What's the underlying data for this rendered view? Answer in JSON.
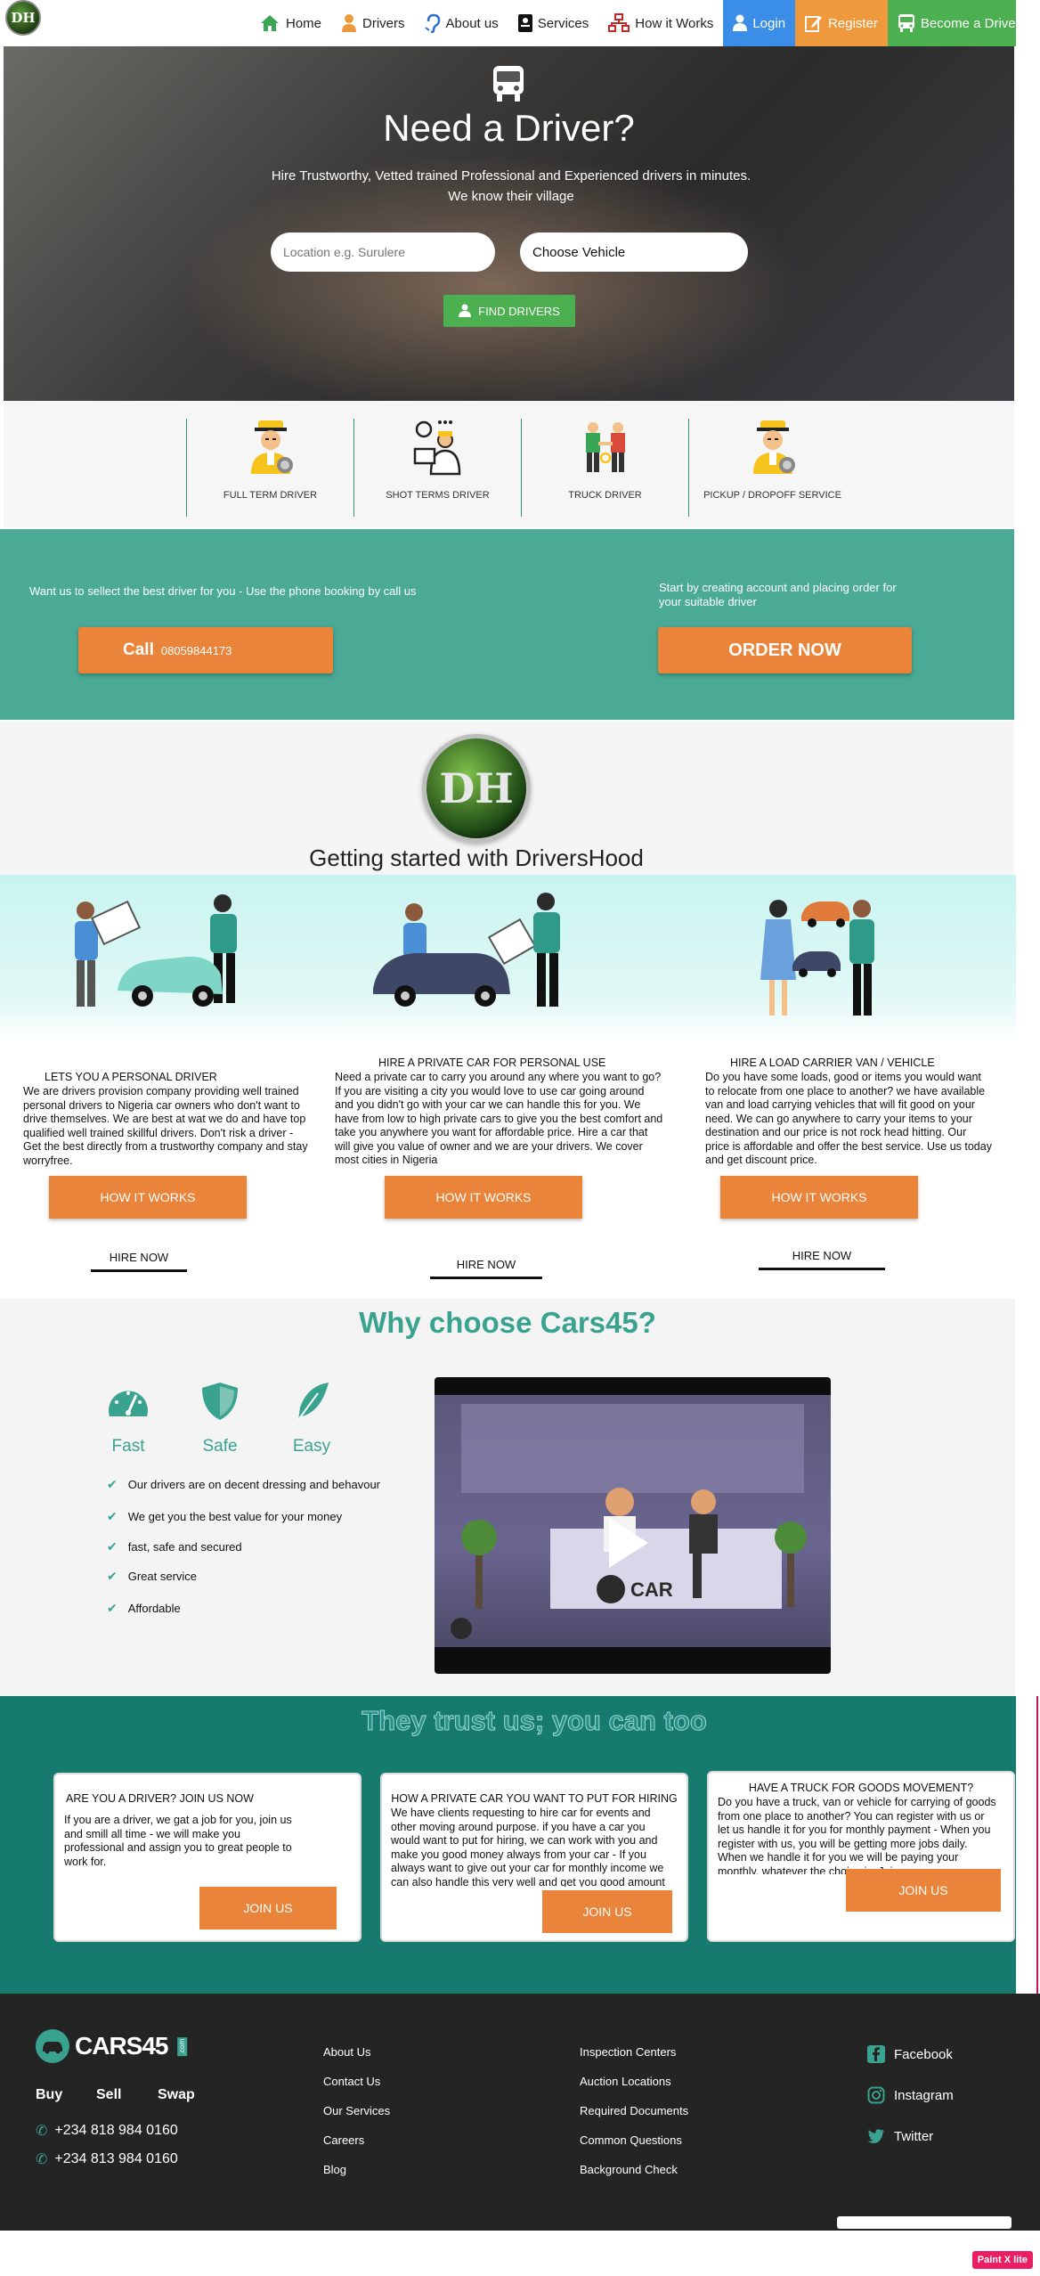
{
  "nav": {
    "items": [
      {
        "label": "Home",
        "icon": "home-icon"
      },
      {
        "label": "Drivers",
        "icon": "driver-icon"
      },
      {
        "label": "About us",
        "icon": "ear-icon"
      },
      {
        "label": "Services",
        "icon": "id-card-icon"
      },
      {
        "label": "How it Works",
        "icon": "sitemap-icon"
      }
    ],
    "login": "Login",
    "register": "Register",
    "become": "Become a Driver"
  },
  "hero": {
    "title": "Need a Driver?",
    "subtitle": "Hire Trustworthy, Vetted trained Professional and Experienced drivers in minutes. We know their village",
    "location_placeholder": "Location e.g. Surulere",
    "vehicle_select": "Choose Vehicle",
    "find_button": "FIND DRIVERS"
  },
  "services": [
    {
      "label": "FULL TERM DRIVER"
    },
    {
      "label": "SHOT TERMS DRIVER"
    },
    {
      "label": "TRUCK DRIVER"
    },
    {
      "label": "PICKUP / DROPOFF SERVICE"
    }
  ],
  "booking": {
    "left_text": "Want us to sellect the best driver for you - Use the phone booking by call us",
    "call_label": "Call",
    "call_number": "08059844173",
    "right_text": "Start by creating account and placing order for your suitable driver",
    "order_button": "ORDER NOW"
  },
  "getting_started": {
    "logo_text": "DH",
    "title": "Getting started with DriversHood"
  },
  "steps": [
    {
      "title": "LETS YOU A PERSONAL DRIVER",
      "desc": "We are drivers provision company providing well trained personal drivers to Nigeria car owners who don't want to drive themselves. We are best at wat we do and have top qualified well trained skillful drivers. Don't risk a driver - Get the best directly from a trustworthy company and stay worryfree.",
      "button": "HOW IT WORKS",
      "link": "HIRE NOW"
    },
    {
      "title": "HIRE A PRIVATE CAR FOR PERSONAL USE",
      "desc": "Need a private car to carry you around any where you want to go? If you are visiting a city you would love to use car going around and you didn't go with your car we can handle this for you. We have from low to high private cars to give you the best comfort and take you anywhere you want for affordable price. Hire a car that will give you value of owner and we are your drivers. We cover most cities in Nigeria",
      "button": "HOW IT WORKS",
      "link": "HIRE NOW"
    },
    {
      "title": "HIRE A LOAD CARRIER VAN / VEHICLE",
      "desc": "Do you have some loads, good or items you would want to relocate from one place to another? we have available van and load carrying vehicles that will fit good on your need. We can go anywhere to carry your items to your destination and our price is not rock head hitting. Our price is affordable and offer the best service. Use us today and get discount price.",
      "button": "HOW IT WORKS",
      "link": "HIRE NOW"
    }
  ],
  "why": {
    "title": "Why choose Cars45?",
    "features": [
      {
        "label": "Fast",
        "icon": "speedometer-icon"
      },
      {
        "label": "Safe",
        "icon": "shield-icon"
      },
      {
        "label": "Easy",
        "icon": "feather-icon"
      }
    ],
    "checks": [
      "Our drivers are on decent dressing and behavour",
      "We get you the best value for your money",
      "fast, safe and secured",
      "Great service",
      "Affordable"
    ]
  },
  "trust": {
    "title": "They trust us; you can too",
    "cards": [
      {
        "title": "ARE YOU A DRIVER? JOIN US NOW",
        "desc": "If you are a driver, we gat a job for you, join us and smill all time - we will make you professional and assign you to great people to work for.",
        "button": "JOIN US"
      },
      {
        "title": "HOW A PRIVATE CAR YOU WANT TO PUT FOR HIRING",
        "desc": "We have clients requesting to hire car for events and other moving around purpose. if you have a car you would want to put for hiring, we can work with you and make you good money always from your car - If you always want to give out your car for monthly income we can also handle this very well and get you good amount monthly",
        "button": "JOIN US"
      },
      {
        "title": "HAVE A TRUCK FOR GOODS MOVEMENT?",
        "desc": "Do you have a truck, van or vehicle for carrying of goods from one place to another? You can register with us or let us handle it for you for monthly payment - When you register with us, you will be getting more jobs daily. When we handle it for you we will be paying your monthly, whatever the choice is. Join us",
        "button": "JOIN US"
      }
    ]
  },
  "footer": {
    "brand": "CARS45",
    "brand_tag": ".com",
    "buy": "Buy",
    "sell": "Sell",
    "swap": "Swap",
    "phones": [
      "+234 818 984 0160",
      "+234 813 984 0160"
    ],
    "col1": [
      "About Us",
      "Contact Us",
      "Our Services",
      "Careers",
      "Blog"
    ],
    "col2": [
      "Inspection Centers",
      "Auction Locations",
      "Required Documents",
      "Common Questions",
      "Background Check"
    ],
    "social": [
      {
        "label": "Facebook",
        "icon": "facebook-icon"
      },
      {
        "label": "Instagram",
        "icon": "instagram-icon"
      },
      {
        "label": "Twitter",
        "icon": "twitter-icon"
      }
    ]
  },
  "badge": "Paint X lite",
  "colors": {
    "teal": "#4aaa95",
    "dark_teal": "#167a6f",
    "orange": "#e9843a",
    "green": "#4caf50",
    "blue": "#3b8ee8"
  }
}
